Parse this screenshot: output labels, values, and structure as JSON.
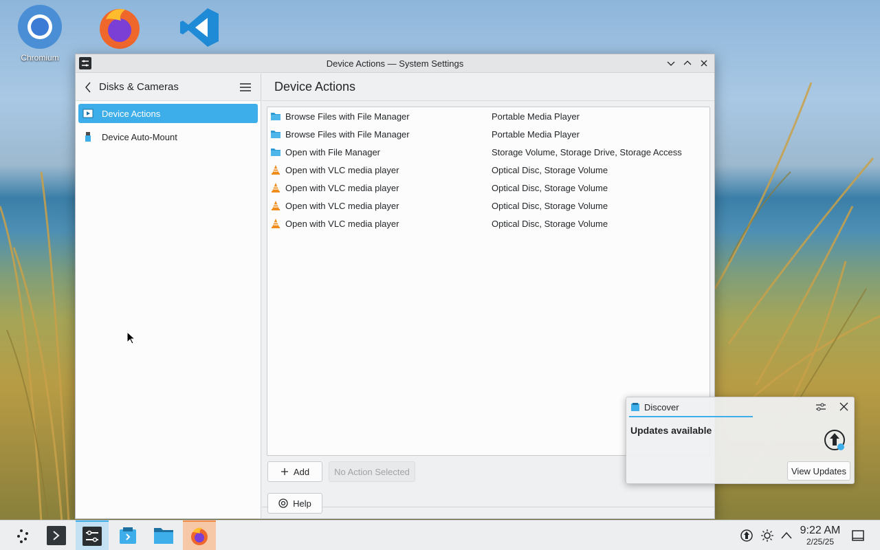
{
  "desktop": {
    "icons": [
      {
        "label": "Chromium",
        "icon": "chromium-icon"
      },
      {
        "label": "",
        "icon": "firefox-icon"
      },
      {
        "label": "",
        "icon": "vscode-icon"
      }
    ]
  },
  "window": {
    "title": "Device Actions — System Settings",
    "sidebar": {
      "header": "Disks & Cameras",
      "items": [
        {
          "label": "Device Actions",
          "selected": true
        },
        {
          "label": "Device Auto-Mount",
          "selected": false
        }
      ]
    },
    "main": {
      "title": "Device Actions",
      "actions": [
        {
          "name": "Browse Files with File Manager",
          "types": "Portable Media Player",
          "icon": "folder-icon"
        },
        {
          "name": "Browse Files with File Manager",
          "types": "Portable Media Player",
          "icon": "folder-icon"
        },
        {
          "name": "Open with File Manager",
          "types": "Storage Volume, Storage Drive, Storage Access",
          "icon": "folder-icon"
        },
        {
          "name": "Open with VLC media player",
          "types": "Optical Disc, Storage Volume",
          "icon": "vlc-icon"
        },
        {
          "name": "Open with VLC media player",
          "types": "Optical Disc, Storage Volume",
          "icon": "vlc-icon"
        },
        {
          "name": "Open with VLC media player",
          "types": "Optical Disc, Storage Volume",
          "icon": "vlc-icon"
        },
        {
          "name": "Open with VLC media player",
          "types": "Optical Disc, Storage Volume",
          "icon": "vlc-icon"
        }
      ],
      "add_label": "Add",
      "no_action_label": "No Action Selected",
      "help_label": "Help"
    }
  },
  "notification": {
    "app": "Discover",
    "title": "Updates available",
    "button": "View Updates"
  },
  "taskbar": {
    "time": "9:22 AM",
    "date": "2/25/25"
  }
}
